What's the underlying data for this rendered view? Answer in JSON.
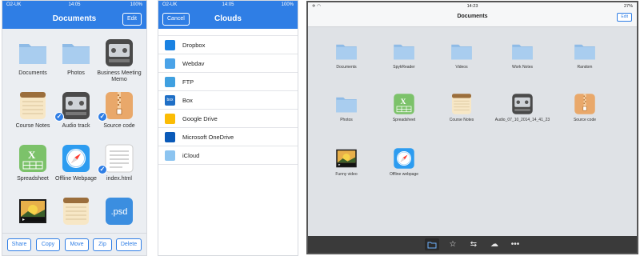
{
  "documents_screen": {
    "status": {
      "carrier": "O2-UK",
      "time": "14:05",
      "battery": "100%"
    },
    "title": "Documents",
    "edit_label": "Edit",
    "items": [
      {
        "label": "Documents",
        "type": "folder"
      },
      {
        "label": "Photos",
        "type": "folder"
      },
      {
        "label": "Business Meeting Memo",
        "type": "recorder"
      },
      {
        "label": "Course Notes",
        "type": "notes"
      },
      {
        "label": "Audio track",
        "type": "recorder",
        "checked": true
      },
      {
        "label": "Source code",
        "type": "zip",
        "checked": true
      },
      {
        "label": "Spreadsheet",
        "type": "spreadsheet"
      },
      {
        "label": "Offline Webpage",
        "type": "safari"
      },
      {
        "label": "index.html",
        "type": "text",
        "checked": true
      },
      {
        "label": "",
        "type": "image"
      },
      {
        "label": "",
        "type": "notes"
      },
      {
        "label": "",
        "type": "psd",
        "icon_text": ".psd"
      }
    ],
    "actions": [
      "Share",
      "Copy",
      "Move",
      "Zip",
      "Delete"
    ]
  },
  "clouds_screen": {
    "status": {
      "carrier": "O2-UK",
      "time": "14:05",
      "battery": "100%"
    },
    "title": "Clouds",
    "cancel_label": "Cancel",
    "services": [
      {
        "label": "Dropbox",
        "color": "#1a82e2"
      },
      {
        "label": "Webdav",
        "color": "#4aa3e8"
      },
      {
        "label": "FTP",
        "color": "#3fa0e0"
      },
      {
        "label": "Box",
        "color": "#1f6fc6",
        "icon_text": "box"
      },
      {
        "label": "Google Drive",
        "color": "#fbbc05"
      },
      {
        "label": "Microsoft OneDrive",
        "color": "#0a5ab8"
      },
      {
        "label": "iCloud",
        "color": "#8cc4f0"
      }
    ]
  },
  "ipad_screen": {
    "status": {
      "time": "14:23",
      "battery": "27%"
    },
    "title": "Documents",
    "edit_label": "Edit",
    "items": [
      {
        "label": "Documents",
        "type": "folder"
      },
      {
        "label": "SpykReader",
        "type": "folder"
      },
      {
        "label": "Videos",
        "type": "folder"
      },
      {
        "label": "Work Notes",
        "type": "folder"
      },
      {
        "label": "Random",
        "type": "folder"
      },
      {
        "label": "Photos",
        "type": "folder"
      },
      {
        "label": "Spreadsheet",
        "type": "spreadsheet"
      },
      {
        "label": "Course Notes",
        "type": "notes"
      },
      {
        "label": "Audio_07_10_2014_14_41_23",
        "type": "recorder"
      },
      {
        "label": "Source code",
        "type": "zip"
      },
      {
        "label": "Funny video",
        "type": "image"
      },
      {
        "label": "Offline webpage",
        "type": "safari"
      }
    ],
    "toolbar": [
      "folder-icon",
      "star-icon",
      "transfer-icon",
      "cloud-icon",
      "more-icon"
    ]
  },
  "colors": {
    "accent": "#2f7ee5",
    "folder": "#8fbbe6",
    "background": "#ebeef2"
  }
}
